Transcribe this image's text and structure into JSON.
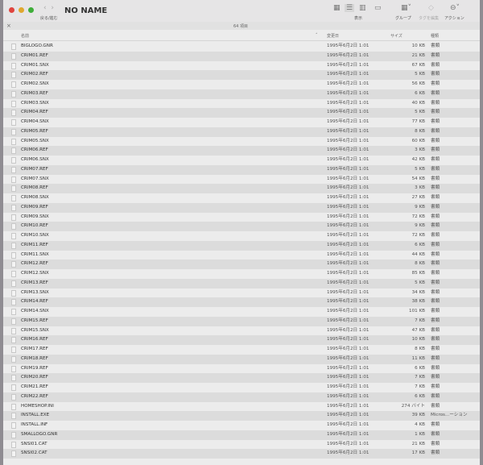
{
  "window": {
    "title": "NO NAME",
    "item_count": "64 項目"
  },
  "toolbar": {
    "back_forward": "戻る/進む",
    "view": "表示",
    "group": "グループ",
    "edit_tags": "タグを編集",
    "action": "アクション"
  },
  "columns": {
    "name": "名前",
    "date": "変更日",
    "size": "サイズ",
    "kind": "種類"
  },
  "files": [
    [
      "BIGLOGO.GNR",
      "1995年6月2日 1:01",
      "10 KB",
      "書類"
    ],
    [
      "CRIM01.REF",
      "1995年6月2日 1:01",
      "21 KB",
      "書類"
    ],
    [
      "CRIM01.SNX",
      "1995年6月2日 1:01",
      "67 KB",
      "書類"
    ],
    [
      "CRIM02.REF",
      "1995年6月2日 1:01",
      "5 KB",
      "書類"
    ],
    [
      "CRIM02.SNX",
      "1995年6月2日 1:01",
      "56 KB",
      "書類"
    ],
    [
      "CRIM03.REF",
      "1995年6月2日 1:01",
      "6 KB",
      "書類"
    ],
    [
      "CRIM03.SNX",
      "1995年6月2日 1:01",
      "40 KB",
      "書類"
    ],
    [
      "CRIM04.REF",
      "1995年6月2日 1:01",
      "5 KB",
      "書類"
    ],
    [
      "CRIM04.SNX",
      "1995年6月2日 1:01",
      "77 KB",
      "書類"
    ],
    [
      "CRIM05.REF",
      "1995年6月2日 1:01",
      "8 KB",
      "書類"
    ],
    [
      "CRIM05.SNX",
      "1995年6月2日 1:01",
      "60 KB",
      "書類"
    ],
    [
      "CRIM06.REF",
      "1995年6月2日 1:01",
      "3 KB",
      "書類"
    ],
    [
      "CRIM06.SNX",
      "1995年6月2日 1:01",
      "42 KB",
      "書類"
    ],
    [
      "CRIM07.REF",
      "1995年6月2日 1:01",
      "5 KB",
      "書類"
    ],
    [
      "CRIM07.SNX",
      "1995年6月2日 1:01",
      "54 KB",
      "書類"
    ],
    [
      "CRIM08.REF",
      "1995年6月2日 1:01",
      "3 KB",
      "書類"
    ],
    [
      "CRIM08.SNX",
      "1995年6月2日 1:01",
      "27 KB",
      "書類"
    ],
    [
      "CRIM09.REF",
      "1995年6月2日 1:01",
      "9 KB",
      "書類"
    ],
    [
      "CRIM09.SNX",
      "1995年6月2日 1:01",
      "72 KB",
      "書類"
    ],
    [
      "CRIM10.REF",
      "1995年6月2日 1:01",
      "9 KB",
      "書類"
    ],
    [
      "CRIM10.SNX",
      "1995年6月2日 1:01",
      "72 KB",
      "書類"
    ],
    [
      "CRIM11.REF",
      "1995年6月2日 1:01",
      "6 KB",
      "書類"
    ],
    [
      "CRIM11.SNX",
      "1995年6月2日 1:01",
      "44 KB",
      "書類"
    ],
    [
      "CRIM12.REF",
      "1995年6月2日 1:01",
      "8 KB",
      "書類"
    ],
    [
      "CRIM12.SNX",
      "1995年6月2日 1:01",
      "85 KB",
      "書類"
    ],
    [
      "CRIM13.REF",
      "1995年6月2日 1:01",
      "5 KB",
      "書類"
    ],
    [
      "CRIM13.SNX",
      "1995年6月2日 1:01",
      "34 KB",
      "書類"
    ],
    [
      "CRIM14.REF",
      "1995年6月2日 1:01",
      "38 KB",
      "書類"
    ],
    [
      "CRIM14.SNX",
      "1995年6月2日 1:01",
      "101 KB",
      "書類"
    ],
    [
      "CRIM15.REF",
      "1995年6月2日 1:01",
      "7 KB",
      "書類"
    ],
    [
      "CRIM15.SNX",
      "1995年6月2日 1:01",
      "47 KB",
      "書類"
    ],
    [
      "CRIM16.REF",
      "1995年6月2日 1:01",
      "10 KB",
      "書類"
    ],
    [
      "CRIM17.REF",
      "1995年6月2日 1:01",
      "8 KB",
      "書類"
    ],
    [
      "CRIM18.REF",
      "1995年6月2日 1:01",
      "11 KB",
      "書類"
    ],
    [
      "CRIM19.REF",
      "1995年6月2日 1:01",
      "6 KB",
      "書類"
    ],
    [
      "CRIM20.REF",
      "1995年6月2日 1:01",
      "7 KB",
      "書類"
    ],
    [
      "CRIM21.REF",
      "1995年6月2日 1:01",
      "7 KB",
      "書類"
    ],
    [
      "CRIM22.REF",
      "1995年6月2日 1:01",
      "6 KB",
      "書類"
    ],
    [
      "HOMESHOP.INI",
      "1995年6月2日 1:01",
      "274 バイト",
      "書類"
    ],
    [
      "INSTALL.EXE",
      "1995年6月2日 1:01",
      "39 KB",
      "Micros...ーション"
    ],
    [
      "INSTALL.INF",
      "1995年6月2日 1:01",
      "4 KB",
      "書類"
    ],
    [
      "SMALLOGO.GNR",
      "1995年6月2日 1:01",
      "1 KB",
      "書類"
    ],
    [
      "SNSI01.CAT",
      "1995年6月2日 1:01",
      "21 KB",
      "書類"
    ],
    [
      "SNSI02.CAT",
      "1995年6月2日 1:01",
      "17 KB",
      "書類"
    ]
  ]
}
